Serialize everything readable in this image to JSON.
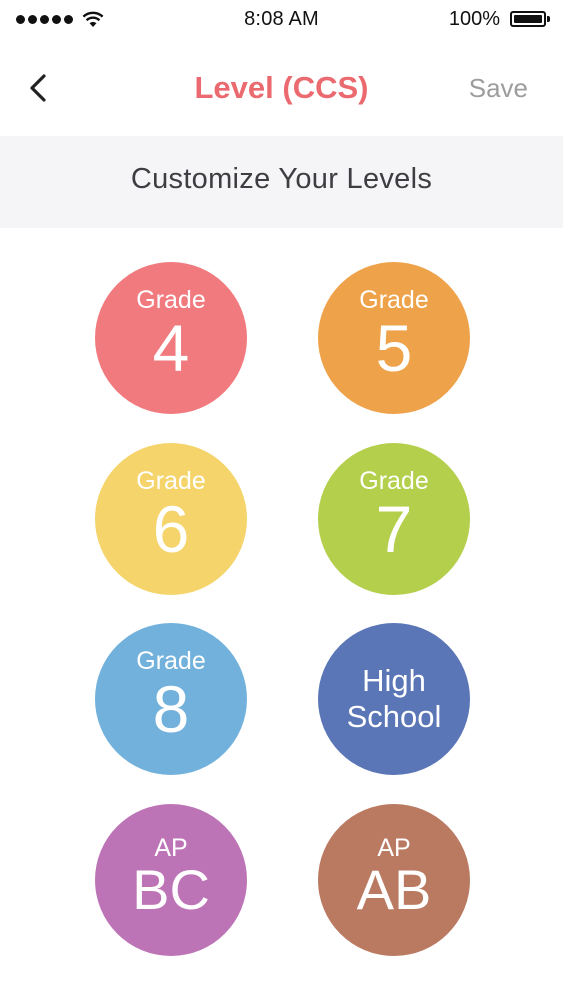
{
  "status_bar": {
    "time": "8:08 AM",
    "battery_percent": "100%",
    "signal_icon": "signal-dots-icon",
    "wifi_icon": "wifi-icon",
    "battery_icon": "battery-icon"
  },
  "nav": {
    "back_icon": "chevron-left-icon",
    "title": "Level (CCS)",
    "save_label": "Save",
    "title_color": "#ea6a6f"
  },
  "section": {
    "title": "Customize Your Levels"
  },
  "levels": [
    {
      "small": "Grade",
      "big": "4",
      "color": "#f07a7e"
    },
    {
      "small": "Grade",
      "big": "5",
      "color": "#eea24a"
    },
    {
      "small": "Grade",
      "big": "6",
      "color": "#f4d46b"
    },
    {
      "small": "Grade",
      "big": "7",
      "color": "#b3cf4b"
    },
    {
      "small": "Grade",
      "big": "8",
      "color": "#72b1dc"
    },
    {
      "line1": "High",
      "line2": "School",
      "color": "#5a76b6"
    },
    {
      "small": "AP",
      "big": "BC",
      "color": "#bd74b6"
    },
    {
      "small": "AP",
      "big": "AB",
      "color": "#b97a61"
    }
  ]
}
